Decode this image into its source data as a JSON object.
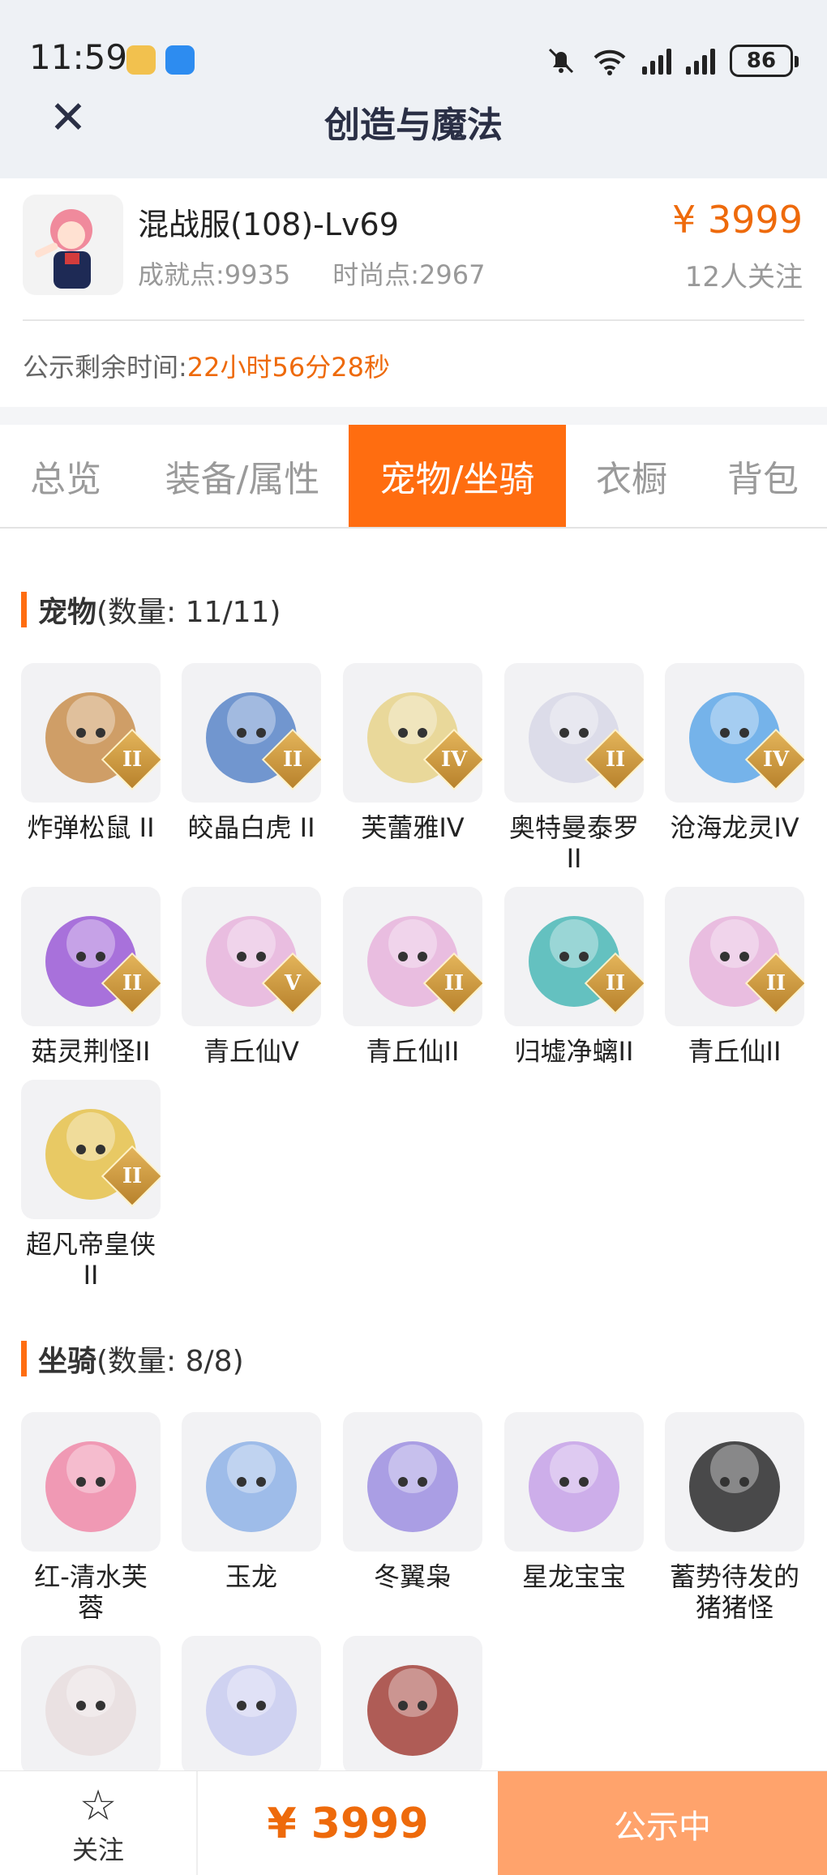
{
  "status_bar": {
    "time": "11:59",
    "battery": "86"
  },
  "header": {
    "title": "创造与魔法"
  },
  "role": {
    "name": "混战服(108)-Lv69",
    "achievement": "成就点:9935",
    "fashion": "时尚点:2967",
    "price": "¥ 3999",
    "followers": "12人关注"
  },
  "countdown": {
    "label": "公示剩余时间:",
    "value": "22小时56分28秒"
  },
  "tabs": [
    "总览",
    "装备/属性",
    "宠物/坐骑",
    "衣橱",
    "背包"
  ],
  "active_tab": "宠物/坐骑",
  "pets": {
    "title": "宠物",
    "count": "(数量: 11/11)",
    "items": [
      {
        "name": "炸弹松鼠 II",
        "badge": "II",
        "color": "#c98f4e"
      },
      {
        "name": "皎晶白虎 II",
        "badge": "II",
        "color": "#5a86c8"
      },
      {
        "name": "芙蕾雅IV",
        "badge": "IV",
        "color": "#e8d38a"
      },
      {
        "name": "奥特曼泰罗\nII",
        "badge": "II",
        "color": "#d8d8e6"
      },
      {
        "name": "沧海龙灵IV",
        "badge": "IV",
        "color": "#5fa8e8"
      },
      {
        "name": "菇灵荆怪II",
        "badge": "II",
        "color": "#9b5bd6"
      },
      {
        "name": "青丘仙V",
        "badge": "V",
        "color": "#e7b4dc"
      },
      {
        "name": "青丘仙II",
        "badge": "II",
        "color": "#e7b4dc"
      },
      {
        "name": "归墟净螭II",
        "badge": "II",
        "color": "#4bb8b6"
      },
      {
        "name": "青丘仙II",
        "badge": "II",
        "color": "#e7b4dc"
      },
      {
        "name": "超凡帝皇侠\nII",
        "badge": "II",
        "color": "#e6c24a"
      }
    ]
  },
  "mounts": {
    "title": "坐骑",
    "count": "(数量: 8/8)",
    "items": [
      {
        "name": "红-清水芙\n蓉",
        "color": "#f08aa8"
      },
      {
        "name": "玉龙",
        "color": "#8fb3e6"
      },
      {
        "name": "冬翼枭",
        "color": "#9d8fe0"
      },
      {
        "name": "星龙宝宝",
        "color": "#c7a2e8"
      },
      {
        "name": "蓄势待发的\n猪猪怪",
        "color": "#2b2b2b"
      },
      {
        "name": "",
        "color": "#e9dede"
      },
      {
        "name": "",
        "color": "#c9cdf0"
      },
      {
        "name": "",
        "color": "#a3423a"
      }
    ]
  },
  "bottom_bar": {
    "follow_label": "关注",
    "price": "¥ 3999",
    "status": "公示中"
  },
  "colors": {
    "accent": "#ff6d10",
    "price": "#ee6a0b",
    "status_button": "#ffa36c"
  }
}
